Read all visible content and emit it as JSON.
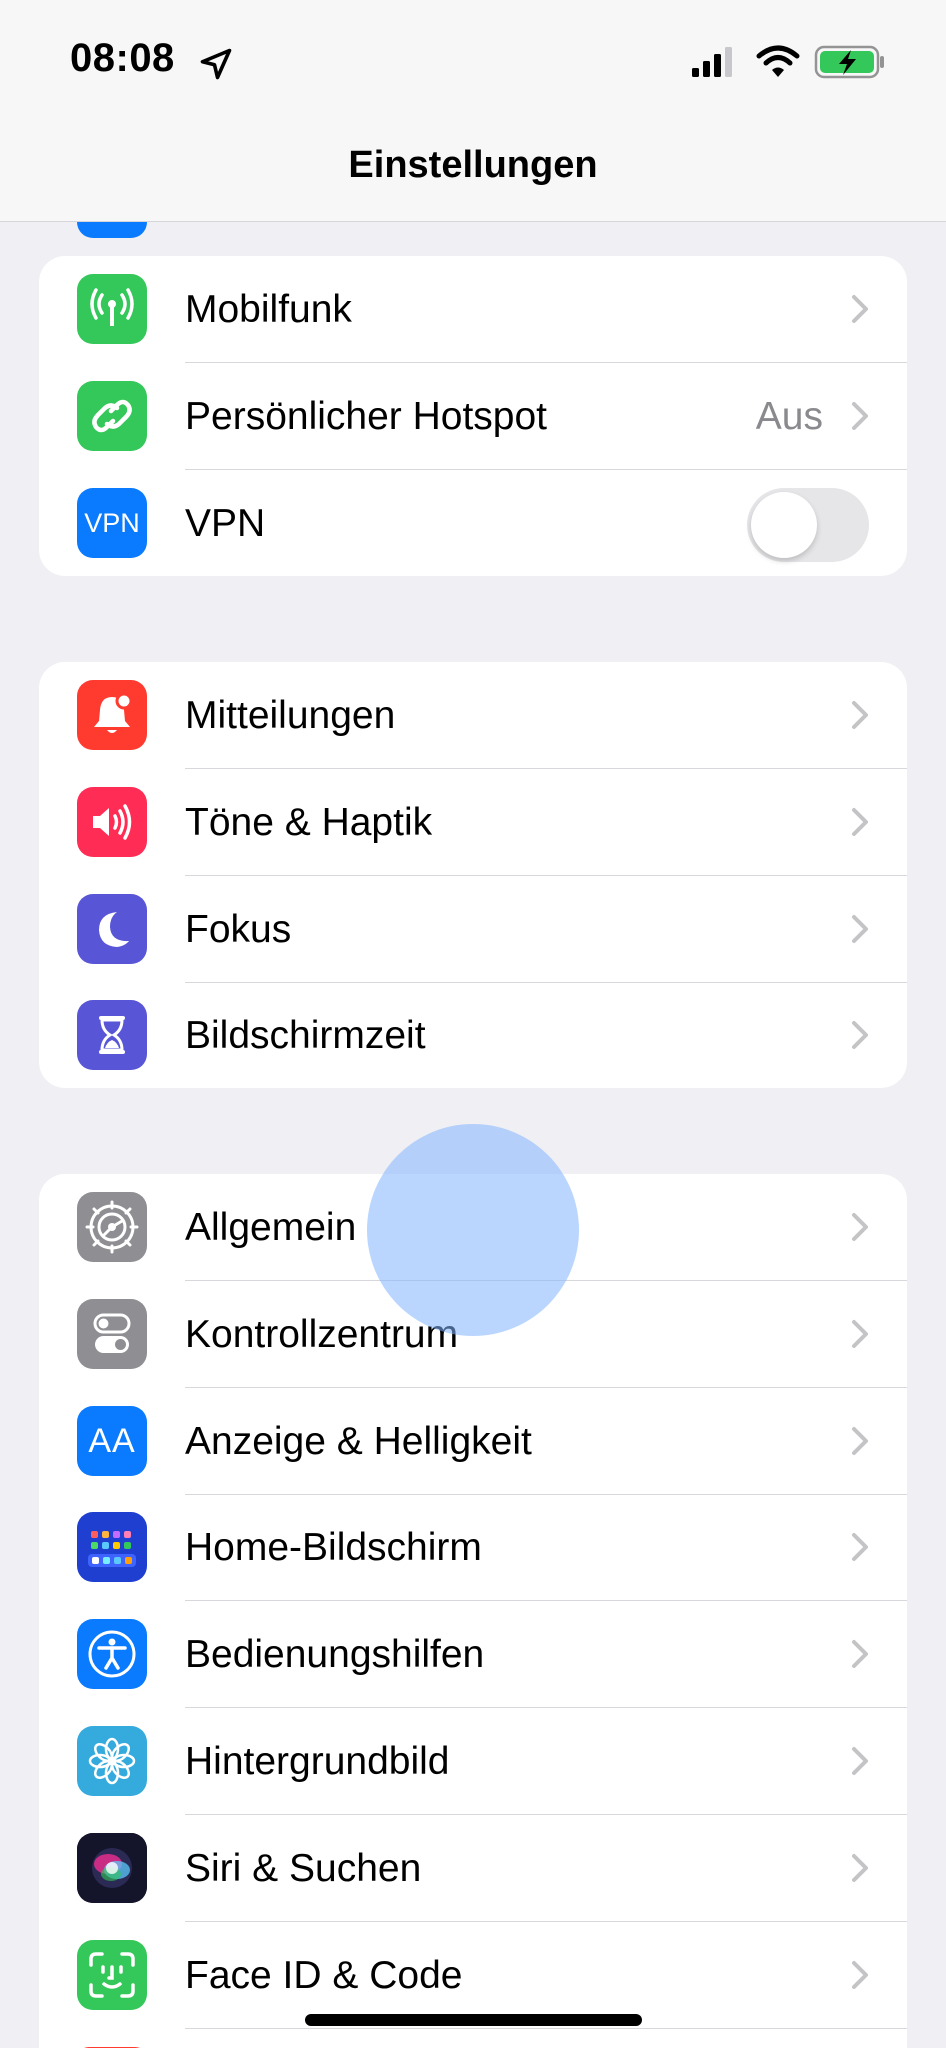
{
  "status_bar": {
    "time": "08:08"
  },
  "nav": {
    "title": "Einstellungen"
  },
  "group_network": {
    "rows": [
      {
        "label": "Mobilfunk",
        "icon": "antenna-icon",
        "color": "#34c759"
      },
      {
        "label": "Persönlicher Hotspot",
        "value": "Aus",
        "icon": "hotspot-chain-icon",
        "color": "#34c759"
      },
      {
        "label": "VPN",
        "icon_text": "VPN",
        "icon": "vpn-icon",
        "color": "#0a7aff",
        "toggle_on": false
      }
    ]
  },
  "group_notifications": {
    "rows": [
      {
        "label": "Mitteilungen",
        "icon": "bell-icon",
        "color": "#ff3b30"
      },
      {
        "label": "Töne & Haptik",
        "icon": "speaker-icon",
        "color": "#ff2d55"
      },
      {
        "label": "Fokus",
        "icon": "moon-icon",
        "color": "#5856d6"
      },
      {
        "label": "Bildschirmzeit",
        "icon": "hourglass-icon",
        "color": "#5856d6"
      }
    ]
  },
  "group_general": {
    "rows": [
      {
        "label": "Allgemein",
        "icon": "gear-icon",
        "color": "#8e8e93"
      },
      {
        "label": "Kontrollzentrum",
        "icon": "switches-icon",
        "color": "#8e8e93"
      },
      {
        "label": "Anzeige & Helligkeit",
        "icon_text": "AA",
        "icon": "text-size-icon",
        "color": "#0a7aff"
      },
      {
        "label": "Home-Bildschirm",
        "icon": "app-grid-icon",
        "color": "#1e3fcf"
      },
      {
        "label": "Bedienungshilfen",
        "icon": "accessibility-icon",
        "color": "#0a7aff"
      },
      {
        "label": "Hintergrundbild",
        "icon": "flower-icon",
        "color": "#35aadc"
      },
      {
        "label": "Siri & Suchen",
        "icon": "siri-icon",
        "color": "#1a1a2e"
      },
      {
        "label": "Face ID & Code",
        "icon": "face-id-icon",
        "color": "#34c759"
      }
    ]
  }
}
